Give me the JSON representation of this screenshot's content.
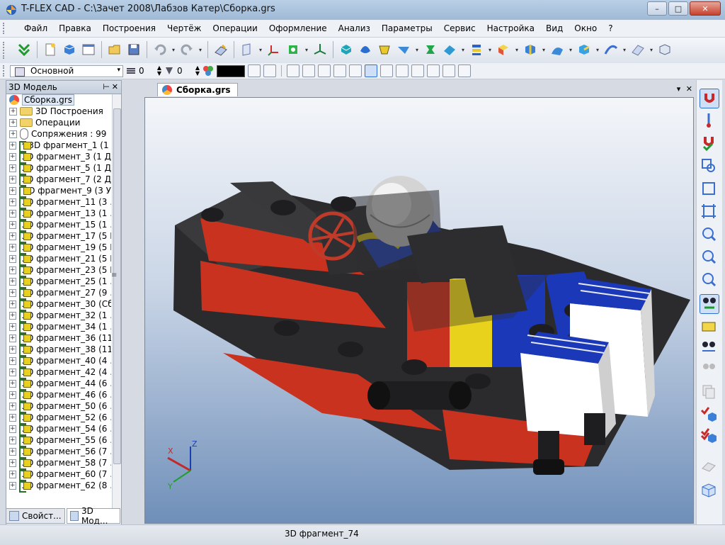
{
  "window": {
    "title": "T-FLEX CAD - C:\\Зачет 2008\\Лабзов Катер\\Сборка.grs"
  },
  "menu": [
    "Файл",
    "Правка",
    "Построения",
    "Чертёж",
    "Операции",
    "Оформление",
    "Анализ",
    "Параметры",
    "Сервис",
    "Настройка",
    "Вид",
    "Окно",
    "?"
  ],
  "toolbar2": {
    "layer": "Основной",
    "level_value": "0",
    "priority_value": "0"
  },
  "panel": {
    "title": "3D Модель",
    "root": "Сборка.grs",
    "items": [
      {
        "label": "3D Построения",
        "type": "folder"
      },
      {
        "label": "Операции",
        "type": "folder"
      },
      {
        "label": "Сопряжения : 99",
        "type": "mate"
      },
      {
        "label": "* 3D фрагмент_1 (1 ...",
        "type": "frag"
      },
      {
        "label": "3D фрагмент_3 (1 Д",
        "type": "frag"
      },
      {
        "label": "3D фрагмент_5 (1 Д",
        "type": "frag"
      },
      {
        "label": "3D фрагмент_7 (2 Д",
        "type": "frag"
      },
      {
        "label": "3D фрагмент_9 (3 У",
        "type": "frag"
      },
      {
        "label": "3D фрагмент_11 (3 ...",
        "type": "frag"
      },
      {
        "label": "3D фрагмент_13 (1 ...",
        "type": "frag"
      },
      {
        "label": "3D фрагмент_15 (1 ...",
        "type": "frag"
      },
      {
        "label": "3D фрагмент_17 (5 I",
        "type": "frag"
      },
      {
        "label": "3D фрагмент_19 (5 I",
        "type": "frag"
      },
      {
        "label": "3D фрагмент_21 (5 I",
        "type": "frag"
      },
      {
        "label": "3D фрагмент_23 (5 I",
        "type": "frag"
      },
      {
        "label": "3D фрагмент_25 (1 ...",
        "type": "frag"
      },
      {
        "label": "3D фрагмент_27 (9 ...",
        "type": "frag"
      },
      {
        "label": "3D фрагмент_30 (Сб",
        "type": "frag"
      },
      {
        "label": "3D фрагмент_32 (1 ...",
        "type": "frag"
      },
      {
        "label": "3D фрагмент_34 (1 ...",
        "type": "frag"
      },
      {
        "label": "3D фрагмент_36 (11",
        "type": "frag"
      },
      {
        "label": "3D фрагмент_38 (11",
        "type": "frag"
      },
      {
        "label": "3D фрагмент_40 (4 ...",
        "type": "frag"
      },
      {
        "label": "3D фрагмент_42 (4 ...",
        "type": "frag"
      },
      {
        "label": "3D фрагмент_44 (6 ...",
        "type": "frag"
      },
      {
        "label": "3D фрагмент_46 (6 ...",
        "type": "frag"
      },
      {
        "label": "3D фрагмент_50 (6 ...",
        "type": "frag"
      },
      {
        "label": "3D фрагмент_52 (6 ...",
        "type": "frag"
      },
      {
        "label": "3D фрагмент_54 (6 ...",
        "type": "frag"
      },
      {
        "label": "3D фрагмент_55 (6 ...",
        "type": "frag"
      },
      {
        "label": "3D фрагмент_56 (7 ...",
        "type": "frag"
      },
      {
        "label": "3D фрагмент_58 (7 ...",
        "type": "frag"
      },
      {
        "label": "3D фрагмент_60 (7 ...",
        "type": "frag"
      },
      {
        "label": "3D фрагмент_62 (8 ...",
        "type": "frag"
      }
    ],
    "tabs": [
      "Свойст...",
      "3D Мод..."
    ]
  },
  "document": {
    "tab": "Сборка.grs"
  },
  "axes": {
    "x": "X",
    "y": "Y",
    "z": "Z"
  },
  "status": "3D фрагмент_74",
  "colors": {
    "accent": "#2f6fce",
    "model_black": "#2a2a2c",
    "model_red": "#c8321e",
    "model_yellow": "#e8d21c",
    "model_blue": "#1b38b8",
    "model_grey": "#c8c8c8"
  }
}
